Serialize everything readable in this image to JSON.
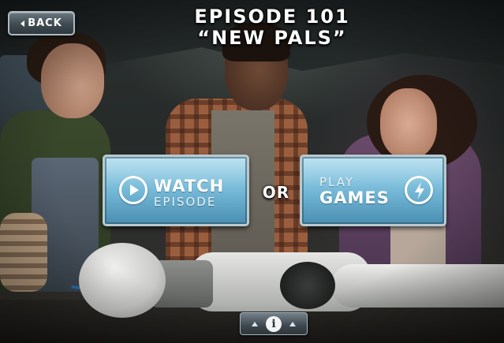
{
  "header": {
    "back_label": "BACK",
    "title_line1": "EPISODE 101",
    "title_line2": "“NEW PALS”"
  },
  "actions": {
    "watch": {
      "line1": "WATCH",
      "line2": "EPISODE",
      "icon": "play-icon"
    },
    "separator": "OR",
    "play": {
      "line1": "PLAY",
      "line2": "GAMES",
      "icon": "lightning-icon"
    }
  },
  "footer": {
    "info_glyph": "i",
    "icons": [
      "arrow-up-icon",
      "info-icon",
      "arrow-up-icon"
    ]
  },
  "colors": {
    "button_fill": "#6fb6d6",
    "button_border": "#b9c9cf",
    "nav_button": "#3f4a51",
    "text": "#ffffff"
  }
}
